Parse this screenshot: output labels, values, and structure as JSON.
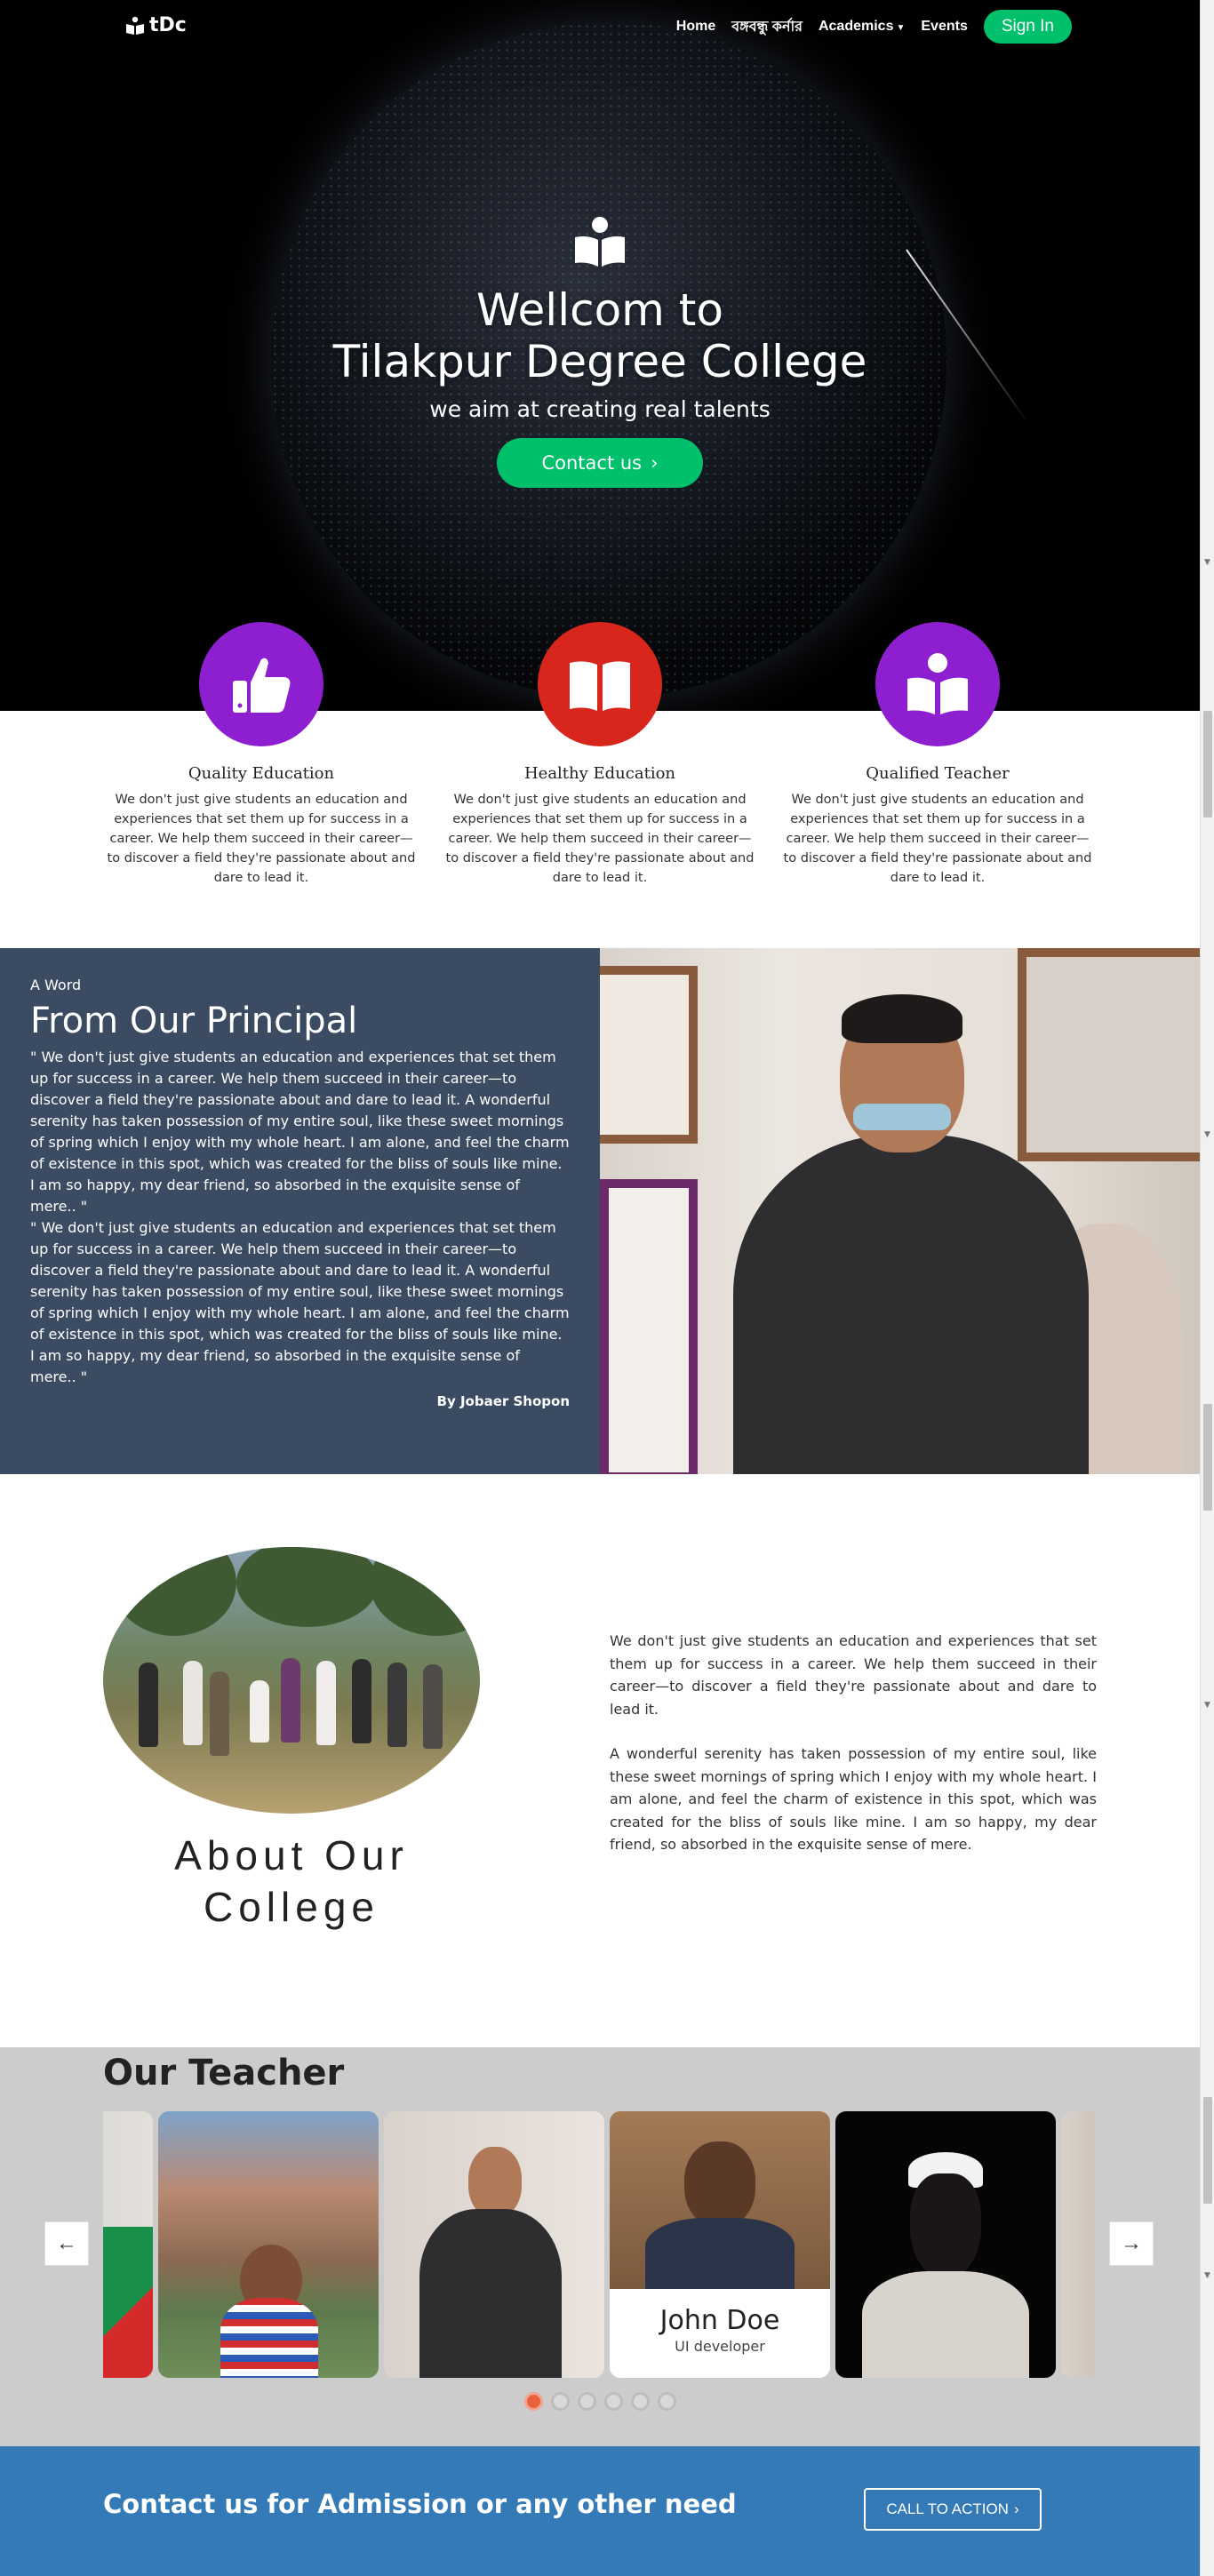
{
  "nav": {
    "logo_text": "tDc",
    "links": [
      "Home",
      "বঙ্গবন্ধু কর্নার",
      "Academics",
      "Events"
    ],
    "signin_label": "Sign In"
  },
  "hero": {
    "title_line1": "Wellcom to",
    "title_line2": "Tilakpur Degree College",
    "subtitle": "we aim at creating real talents",
    "button_label": "Contact us"
  },
  "features": [
    {
      "title": "Quality Education",
      "icon": "thumbs-up-icon",
      "color": "#8e1fd0",
      "text": "We don't just give students an education and experiences that set them up for success in a career. We help them succeed in their career—to discover a field they're passionate about and dare to lead it."
    },
    {
      "title": "Healthy Education",
      "icon": "book-icon",
      "color": "#d9261c",
      "text": "We don't just give students an education and experiences that set them up for success in a career. We help them succeed in their career—to discover a field they're passionate about and dare to lead it."
    },
    {
      "title": "Qualified Teacher",
      "icon": "reader-icon",
      "color": "#8e1fd0",
      "text": "We don't just give students an education and experiences that set them up for success in a career. We help them succeed in their career—to discover a field they're passionate about and dare to lead it."
    }
  ],
  "principal": {
    "kicker": "A Word",
    "title": "From Our Principal",
    "quote1": "\" We don't just give students an education and experiences that set them up for success in a career. We help them succeed in their career—to discover a field they're passionate about and dare to lead it. A wonderful serenity has taken possession of my entire soul, like these sweet mornings of spring which I enjoy with my whole heart. I am alone, and feel the charm of existence in this spot, which was created for the bliss of souls like mine. I am so happy, my dear friend, so absorbed in the exquisite sense of mere.. \"",
    "quote2": "\" We don't just give students an education and experiences that set them up for success in a career. We help them succeed in their career—to discover a field they're passionate about and dare to lead it. A wonderful serenity has taken possession of my entire soul, like these sweet mornings of spring which I enjoy with my whole heart. I am alone, and feel the charm of existence in this spot, which was created for the bliss of souls like mine. I am so happy, my dear friend, so absorbed in the exquisite sense of mere.. \"",
    "byline": "By Jobaer Shopon"
  },
  "about": {
    "heading_line1": "About Our",
    "heading_line2": "College",
    "paragraph1": "We don't just give students an education and experiences that set them up for success in a career. We help them succeed in their career—to discover a field they're passionate about and dare to lead it.",
    "paragraph2": "A wonderful serenity has taken possession of my entire soul, like these sweet mornings of spring which I enjoy with my whole heart. I am alone, and feel the charm of existence in this spot, which was created for the bliss of souls like mine. I am so happy, my dear friend, so absorbed in the exquisite sense of mere."
  },
  "teachers": {
    "title": "Our Teacher",
    "featured_name": "John Doe",
    "featured_role": "UI developer",
    "prev_label": "←",
    "next_label": "→",
    "slide_count": 6,
    "active_slide": 1
  },
  "cta": {
    "text": "Contact us for Admission or any other need",
    "button_label": "CALL TO ACTION"
  },
  "colors": {
    "accent_green": "#00c06b",
    "principal_bg": "#3b4b62",
    "teachers_bg": "#cccccc",
    "cta_bg": "#337ab7",
    "dot_active": "#e8613c"
  }
}
